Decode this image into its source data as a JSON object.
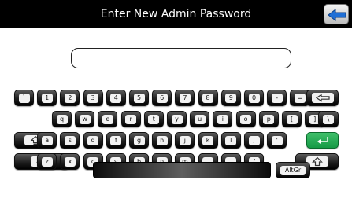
{
  "header": {
    "title": "Enter New Admin Password"
  },
  "password_field": {
    "value": ""
  },
  "keyboard": {
    "rows": [
      [
        {
          "label": "`"
        },
        {
          "label": "1"
        },
        {
          "label": "2"
        },
        {
          "label": "3"
        },
        {
          "label": "4"
        },
        {
          "label": "5"
        },
        {
          "label": "6"
        },
        {
          "label": "7"
        },
        {
          "label": "8"
        },
        {
          "label": "9"
        },
        {
          "label": "0"
        },
        {
          "label": "-"
        },
        {
          "label": "="
        },
        {
          "label": "",
          "icon": "backspace-icon"
        }
      ],
      [
        {
          "label": "q"
        },
        {
          "label": "w"
        },
        {
          "label": "e"
        },
        {
          "label": "r"
        },
        {
          "label": "t"
        },
        {
          "label": "y"
        },
        {
          "label": "u"
        },
        {
          "label": "i"
        },
        {
          "label": "o"
        },
        {
          "label": "p"
        },
        {
          "label": "["
        },
        {
          "label": "]"
        },
        {
          "label": "\\"
        }
      ],
      [
        {
          "label": "",
          "icon": "caps-lock-icon"
        },
        {
          "label": "a"
        },
        {
          "label": "s"
        },
        {
          "label": "d"
        },
        {
          "label": "f"
        },
        {
          "label": "g"
        },
        {
          "label": "h"
        },
        {
          "label": "j"
        },
        {
          "label": "k"
        },
        {
          "label": "l"
        },
        {
          "label": ";"
        },
        {
          "label": "'"
        },
        {
          "label": "",
          "icon": "enter-icon"
        }
      ],
      [
        {
          "label": "",
          "icon": "shift-icon"
        },
        {
          "label": "z"
        },
        {
          "label": "x"
        },
        {
          "label": "c"
        },
        {
          "label": "v"
        },
        {
          "label": "b"
        },
        {
          "label": "n"
        },
        {
          "label": "m"
        },
        {
          "label": ","
        },
        {
          "label": "."
        },
        {
          "label": "/"
        },
        {
          "label": "",
          "icon": "shift-icon"
        }
      ]
    ],
    "altgr_label": "AltGr"
  },
  "icons": {
    "back": "back-arrow-icon"
  },
  "colors": {
    "titlebar": "#000000",
    "enter_key": "#1fa34d",
    "key": "#1a1a1a"
  }
}
